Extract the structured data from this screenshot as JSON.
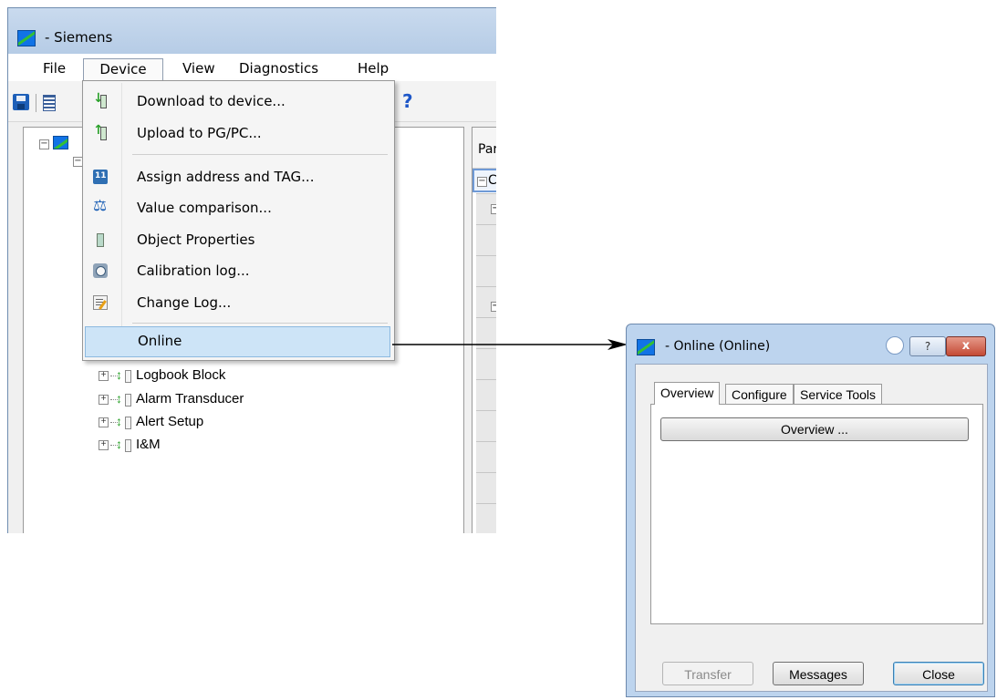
{
  "main_window": {
    "title": "- Siemens",
    "menu": [
      "File",
      "Device",
      "View",
      "Diagnostics",
      "Help"
    ],
    "toolbar": {
      "help_glyph": "?"
    },
    "param_header": "Par",
    "param_row_glyph": "C"
  },
  "device_menu": {
    "items": [
      {
        "label": "Download to device...",
        "icon": "download-icon"
      },
      {
        "label": "Upload to PG/PC...",
        "icon": "upload-icon"
      },
      {
        "label": "Assign address and TAG...",
        "icon": "assign-address-icon"
      },
      {
        "label": "Value comparison...",
        "icon": "value-comparison-icon"
      },
      {
        "label": "Object Properties",
        "icon": "object-properties-icon"
      },
      {
        "label": "Calibration log...",
        "icon": "calibration-log-icon"
      },
      {
        "label": "Change Log...",
        "icon": "change-log-icon"
      },
      {
        "label": "Online",
        "icon": null,
        "highlighted": true
      }
    ]
  },
  "tree": {
    "items": [
      "Logbook Block",
      "Alarm Transducer",
      "Alert Setup",
      "I&M"
    ]
  },
  "online_dialog": {
    "title": "- Online (Online)",
    "help_glyph": "?",
    "close_glyph": "x",
    "tabs": [
      "Overview",
      "Configure",
      "Service Tools"
    ],
    "active_tab": "Overview",
    "overview_button": "Overview ...",
    "buttons": {
      "transfer": "Transfer",
      "messages": "Messages",
      "close": "Close"
    },
    "transfer_disabled": true
  }
}
